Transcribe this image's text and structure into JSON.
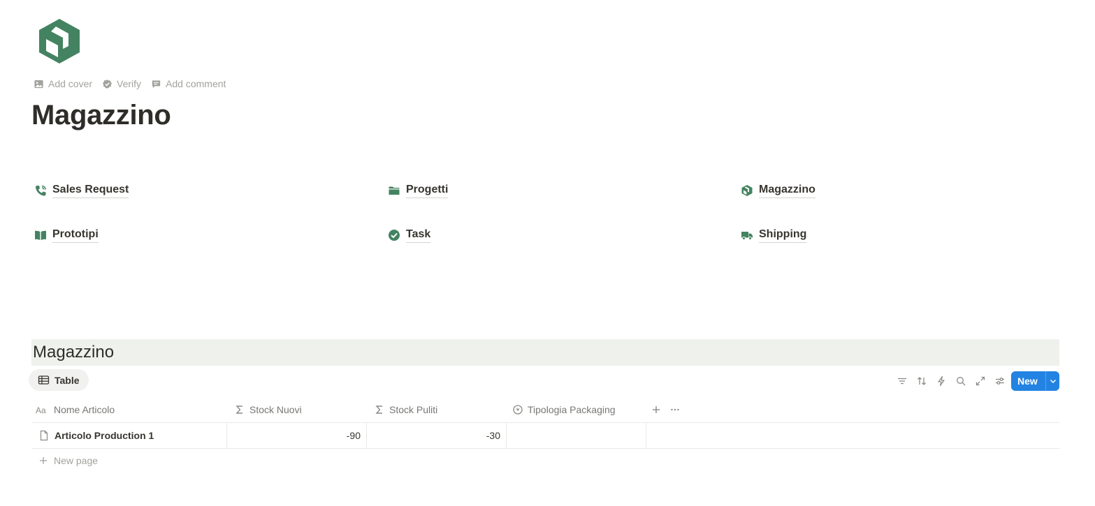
{
  "page": {
    "icon": "warehouse-box-icon",
    "actions": [
      {
        "label": "Add cover",
        "icon": "image-icon"
      },
      {
        "label": "Verify",
        "icon": "verify-badge-icon"
      },
      {
        "label": "Add comment",
        "icon": "comment-icon"
      }
    ],
    "title": "Magazzino"
  },
  "links": [
    {
      "label": "Sales Request",
      "icon": "phone-icon"
    },
    {
      "label": "Progetti",
      "icon": "folder-icon"
    },
    {
      "label": "Magazzino",
      "icon": "box-icon"
    },
    {
      "label": "Prototipi",
      "icon": "book-icon"
    },
    {
      "label": "Task",
      "icon": "check-circle-icon"
    },
    {
      "label": "Shipping",
      "icon": "truck-icon"
    }
  ],
  "database": {
    "title": "Magazzino",
    "view_tab": {
      "label": "Table",
      "icon": "table-icon"
    },
    "toolbar": [
      "filter-icon",
      "sort-icon",
      "automation-icon",
      "search-icon",
      "expand-icon",
      "settings-icon"
    ],
    "new_button": "New",
    "columns": [
      {
        "label": "Nome Articolo",
        "icon": "text-property-icon"
      },
      {
        "label": "Stock Nuovi",
        "icon": "sigma-icon"
      },
      {
        "label": "Stock Puliti",
        "icon": "sigma-icon"
      },
      {
        "label": "Tipologia Packaging",
        "icon": "status-icon"
      }
    ],
    "rows": [
      {
        "name": "Articolo Production 1",
        "stock_nuovi": "-90",
        "stock_puliti": "-30",
        "packaging": ""
      }
    ],
    "new_page_label": "New page"
  },
  "colors": {
    "accent": "#2383e2",
    "icon_green": "#448361",
    "title_bar": "#eef1ec"
  }
}
